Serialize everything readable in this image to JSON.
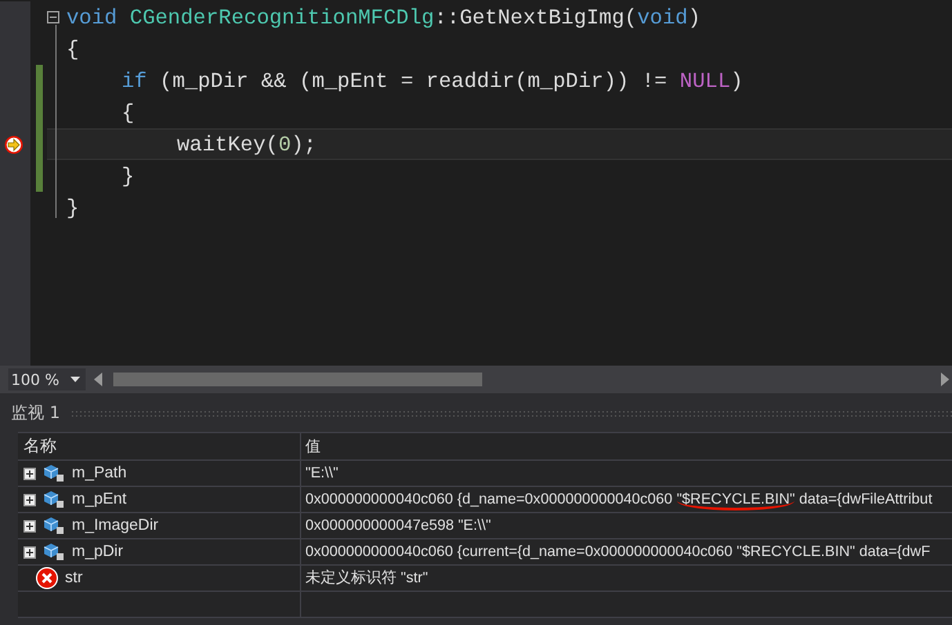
{
  "editor": {
    "lines": [
      {
        "changed": false,
        "current": false,
        "collapsible": true,
        "tokens": [
          {
            "kind": "keyword",
            "text": "void"
          },
          {
            "kind": "type",
            "text": " CGenderRecognitionMFCDlg"
          },
          {
            "kind": "plain",
            "text": "::GetNextBigImg("
          },
          {
            "kind": "keyword",
            "text": "void"
          },
          {
            "kind": "plain",
            "text": ")"
          }
        ]
      },
      {
        "changed": false,
        "current": false,
        "collapsible": false,
        "tokens": [
          {
            "kind": "plain",
            "text": "{"
          }
        ],
        "children": [
          {
            "changed": true,
            "current": false,
            "collapsible": false,
            "tokens": [
              {
                "kind": "keyword",
                "text": "if"
              },
              {
                "kind": "plain",
                "text": " (m_pDir && (m_pEnt = readdir(m_pDir)) != "
              },
              {
                "kind": "macro",
                "text": "NULL"
              },
              {
                "kind": "plain",
                "text": ")"
              }
            ]
          },
          {
            "changed": true,
            "current": false,
            "collapsible": false,
            "tokens": [
              {
                "kind": "plain",
                "text": "{"
              }
            ],
            "children": [
              {
                "changed": true,
                "current": true,
                "collapsible": false,
                "tokens": [
                  {
                    "kind": "plain",
                    "text": "waitKey("
                  },
                  {
                    "kind": "number",
                    "text": "0"
                  },
                  {
                    "kind": "plain",
                    "text": ");"
                  }
                ]
              }
            ]
          },
          {
            "changed": true,
            "current": false,
            "collapsible": false,
            "tokens": [
              {
                "kind": "plain",
                "text": "}"
              }
            ]
          }
        ]
      },
      {
        "changed": false,
        "current": false,
        "collapsible": false,
        "tokens": [
          {
            "kind": "plain",
            "text": "}"
          }
        ]
      }
    ],
    "zoom": "100 %"
  },
  "watch": {
    "title": "监视 1",
    "columns": [
      "名称",
      "值"
    ],
    "rows": [
      {
        "name": "m_Path",
        "kind": "variable",
        "parts": [
          {
            "text": "\"E:\\\\\"",
            "underlined": false
          }
        ]
      },
      {
        "name": "m_pEnt",
        "kind": "variable",
        "parts": [
          {
            "text": "0x000000000040c060 {d_name=0x000000000040c060 ",
            "underlined": false
          },
          {
            "text": "\"$RECYCLE.BIN\"",
            "underlined": true
          },
          {
            "text": " data={dwFileAttribut",
            "underlined": false
          }
        ]
      },
      {
        "name": "m_ImageDir",
        "kind": "variable",
        "parts": [
          {
            "text": "0x000000000047e598 \"E:\\\\\"",
            "underlined": false
          }
        ]
      },
      {
        "name": "m_pDir",
        "kind": "variable",
        "parts": [
          {
            "text": "0x000000000040c060 {current={d_name=0x000000000040c060 \"$RECYCLE.BIN\" data={dwF",
            "underlined": false
          }
        ]
      },
      {
        "name": "str",
        "kind": "error",
        "parts": [
          {
            "text": "未定义标识符 \"str\"",
            "underlined": false
          }
        ]
      }
    ]
  }
}
